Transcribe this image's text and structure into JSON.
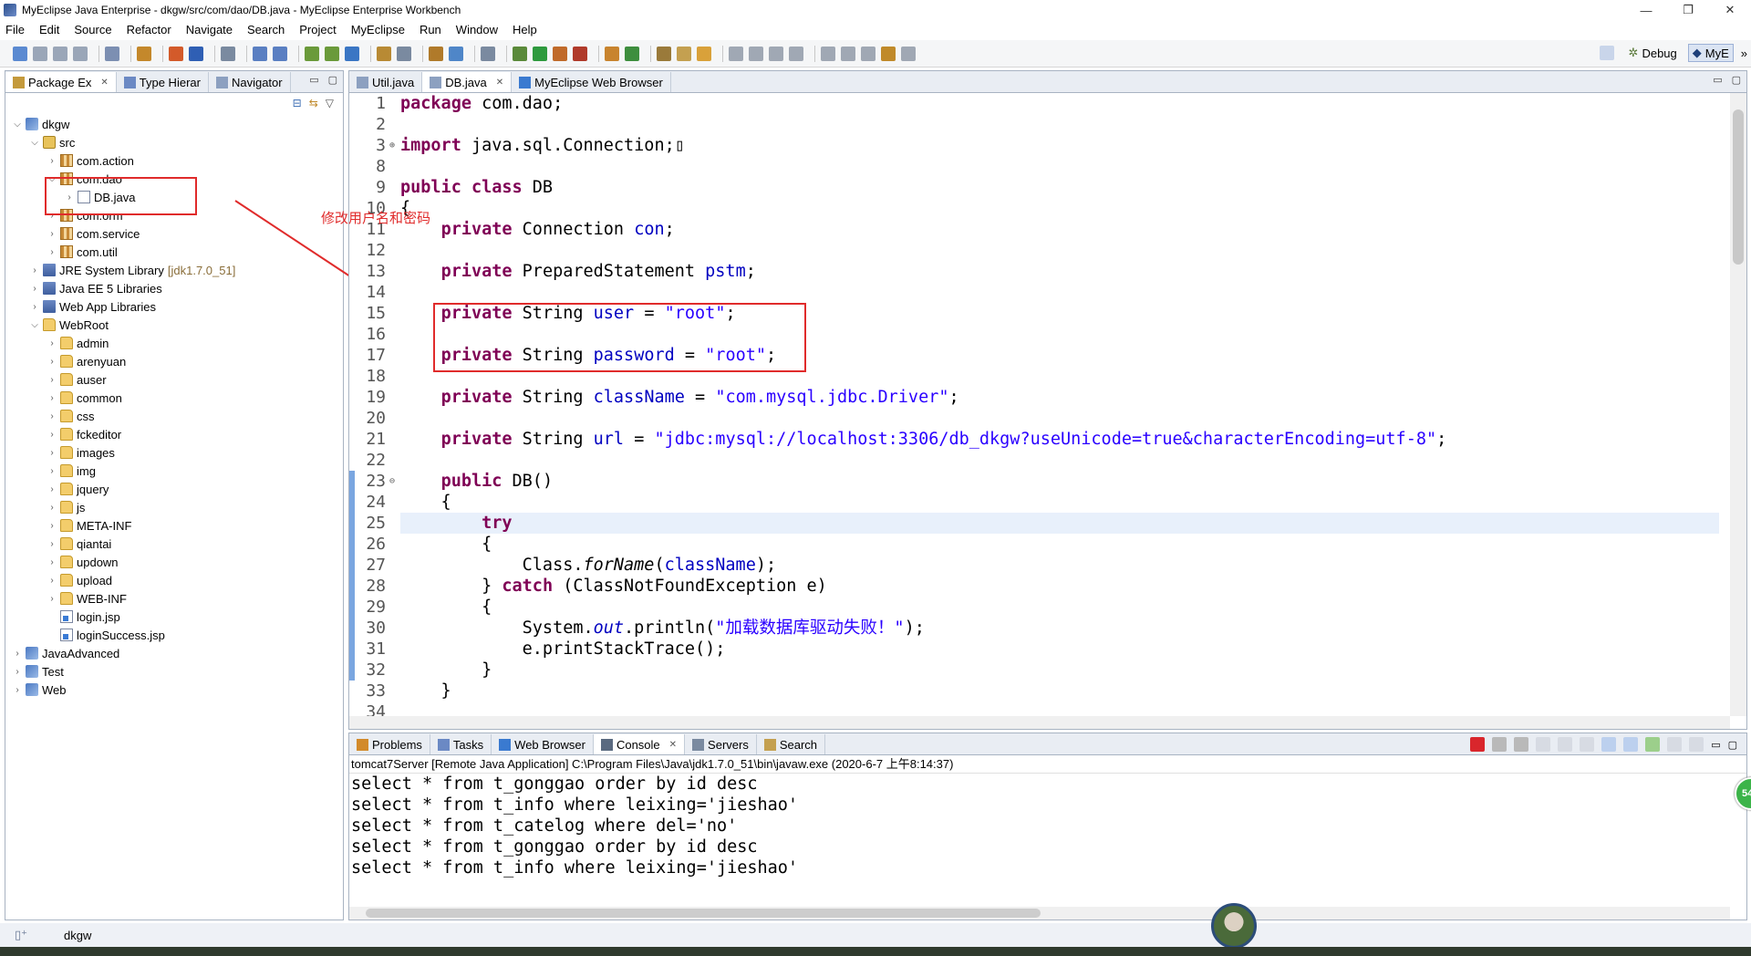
{
  "window": {
    "title": "MyEclipse Java Enterprise - dkgw/src/com/dao/DB.java - MyEclipse Enterprise Workbench",
    "controls": [
      "—",
      "❐",
      "✕"
    ]
  },
  "menubar": [
    "File",
    "Edit",
    "Source",
    "Refactor",
    "Navigate",
    "Search",
    "Project",
    "MyEclipse",
    "Run",
    "Window",
    "Help"
  ],
  "toolbar": {
    "perspectives": [
      {
        "label": "Debug",
        "icon": "debug-icon",
        "active": false
      },
      {
        "label": "MyE",
        "icon": "myeclipse-icon",
        "active": true
      }
    ],
    "overflow": "»"
  },
  "left_panel": {
    "tabs": [
      {
        "label": "Package Ex",
        "icon": "package-explorer-icon",
        "active": true
      },
      {
        "label": "Type Hierar",
        "icon": "type-hierarchy-icon",
        "active": false
      },
      {
        "label": "Navigator",
        "icon": "navigator-icon",
        "active": false
      }
    ],
    "tree": [
      {
        "label": "dkgw",
        "icon": "project",
        "depth": 0,
        "twisty": "open"
      },
      {
        "label": "src",
        "icon": "srcfolder",
        "depth": 1,
        "twisty": "open"
      },
      {
        "label": "com.action",
        "icon": "package",
        "depth": 2,
        "twisty": "closed"
      },
      {
        "label": "com.dao",
        "icon": "package",
        "depth": 2,
        "twisty": "open"
      },
      {
        "label": "DB.java",
        "icon": "java",
        "depth": 3,
        "twisty": "closed"
      },
      {
        "label": "com.orm",
        "icon": "package",
        "depth": 2,
        "twisty": "closed"
      },
      {
        "label": "com.service",
        "icon": "package",
        "depth": 2,
        "twisty": "closed"
      },
      {
        "label": "com.util",
        "icon": "package",
        "depth": 2,
        "twisty": "closed"
      },
      {
        "label": "JRE System Library",
        "suffix": "[jdk1.7.0_51]",
        "icon": "lib",
        "depth": 1,
        "twisty": "closed"
      },
      {
        "label": "Java EE 5 Libraries",
        "icon": "lib",
        "depth": 1,
        "twisty": "closed"
      },
      {
        "label": "Web App Libraries",
        "icon": "lib",
        "depth": 1,
        "twisty": "closed"
      },
      {
        "label": "WebRoot",
        "icon": "folder",
        "depth": 1,
        "twisty": "open"
      },
      {
        "label": "admin",
        "icon": "folder",
        "depth": 2,
        "twisty": "closed"
      },
      {
        "label": "arenyuan",
        "icon": "folder",
        "depth": 2,
        "twisty": "closed"
      },
      {
        "label": "auser",
        "icon": "folder",
        "depth": 2,
        "twisty": "closed"
      },
      {
        "label": "common",
        "icon": "folder",
        "depth": 2,
        "twisty": "closed"
      },
      {
        "label": "css",
        "icon": "folder",
        "depth": 2,
        "twisty": "closed"
      },
      {
        "label": "fckeditor",
        "icon": "folder",
        "depth": 2,
        "twisty": "closed"
      },
      {
        "label": "images",
        "icon": "folder",
        "depth": 2,
        "twisty": "closed"
      },
      {
        "label": "img",
        "icon": "folder",
        "depth": 2,
        "twisty": "closed"
      },
      {
        "label": "jquery",
        "icon": "folder",
        "depth": 2,
        "twisty": "closed"
      },
      {
        "label": "js",
        "icon": "folder",
        "depth": 2,
        "twisty": "closed"
      },
      {
        "label": "META-INF",
        "icon": "folder",
        "depth": 2,
        "twisty": "closed"
      },
      {
        "label": "qiantai",
        "icon": "folder",
        "depth": 2,
        "twisty": "closed"
      },
      {
        "label": "updown",
        "icon": "folder",
        "depth": 2,
        "twisty": "closed"
      },
      {
        "label": "upload",
        "icon": "folder",
        "depth": 2,
        "twisty": "closed"
      },
      {
        "label": "WEB-INF",
        "icon": "folder",
        "depth": 2,
        "twisty": "closed"
      },
      {
        "label": "login.jsp",
        "icon": "jsp",
        "depth": 2,
        "twisty": "none"
      },
      {
        "label": "loginSuccess.jsp",
        "icon": "jsp",
        "depth": 2,
        "twisty": "none"
      },
      {
        "label": "JavaAdvanced",
        "icon": "project",
        "depth": 0,
        "twisty": "closed"
      },
      {
        "label": "Test",
        "icon": "project",
        "depth": 0,
        "twisty": "closed"
      },
      {
        "label": "Web",
        "icon": "project",
        "depth": 0,
        "twisty": "closed"
      }
    ]
  },
  "editor": {
    "tabs": [
      {
        "label": "Util.java",
        "icon": "java-file-icon",
        "active": false,
        "closable": false
      },
      {
        "label": "DB.java",
        "icon": "java-file-icon",
        "active": true,
        "closable": true
      },
      {
        "label": "MyEclipse Web Browser",
        "icon": "globe-icon",
        "active": false,
        "closable": false
      }
    ],
    "annotation": "修改用户名和密码",
    "lines": [
      {
        "n": "1",
        "tokens": [
          [
            "kw",
            "package"
          ],
          [
            "t",
            " com.dao;"
          ]
        ]
      },
      {
        "n": "2",
        "tokens": []
      },
      {
        "n": "3",
        "fold": "⊕",
        "tokens": [
          [
            "kw",
            "import"
          ],
          [
            "t",
            " java.sql.Connection;"
          ],
          [
            "t",
            "▯"
          ]
        ]
      },
      {
        "n": "8",
        "tokens": []
      },
      {
        "n": "9",
        "tokens": [
          [
            "kw",
            "public class"
          ],
          [
            "t",
            " DB"
          ]
        ]
      },
      {
        "n": "10",
        "tokens": [
          [
            "t",
            "{"
          ]
        ]
      },
      {
        "n": "11",
        "tokens": [
          [
            "t",
            "    "
          ],
          [
            "kw",
            "private"
          ],
          [
            "t",
            " Connection "
          ],
          [
            "fld",
            "con"
          ],
          [
            "t",
            ";"
          ]
        ]
      },
      {
        "n": "12",
        "tokens": []
      },
      {
        "n": "13",
        "tokens": [
          [
            "t",
            "    "
          ],
          [
            "kw",
            "private"
          ],
          [
            "t",
            " PreparedStatement "
          ],
          [
            "fld",
            "pstm"
          ],
          [
            "t",
            ";"
          ]
        ]
      },
      {
        "n": "14",
        "tokens": []
      },
      {
        "n": "15",
        "tokens": [
          [
            "t",
            "    "
          ],
          [
            "kw",
            "private"
          ],
          [
            "t",
            " String "
          ],
          [
            "fld",
            "user"
          ],
          [
            "t",
            " = "
          ],
          [
            "str",
            "\"root\""
          ],
          [
            "t",
            ";"
          ]
        ]
      },
      {
        "n": "16",
        "tokens": []
      },
      {
        "n": "17",
        "tokens": [
          [
            "t",
            "    "
          ],
          [
            "kw",
            "private"
          ],
          [
            "t",
            " String "
          ],
          [
            "fld",
            "password"
          ],
          [
            "t",
            " = "
          ],
          [
            "str",
            "\"root\""
          ],
          [
            "t",
            ";"
          ]
        ]
      },
      {
        "n": "18",
        "tokens": []
      },
      {
        "n": "19",
        "tokens": [
          [
            "t",
            "    "
          ],
          [
            "kw",
            "private"
          ],
          [
            "t",
            " String "
          ],
          [
            "fld",
            "className"
          ],
          [
            "t",
            " = "
          ],
          [
            "str",
            "\"com.mysql.jdbc.Driver\""
          ],
          [
            "t",
            ";"
          ]
        ]
      },
      {
        "n": "20",
        "tokens": []
      },
      {
        "n": "21",
        "tokens": [
          [
            "t",
            "    "
          ],
          [
            "kw",
            "private"
          ],
          [
            "t",
            " String "
          ],
          [
            "fld",
            "url"
          ],
          [
            "t",
            " = "
          ],
          [
            "str",
            "\"jdbc:mysql://localhost:3306/db_dkgw?useUnicode=true&characterEncoding=utf-8\""
          ],
          [
            "t",
            ";"
          ]
        ]
      },
      {
        "n": "22",
        "tokens": []
      },
      {
        "n": "23",
        "fold": "⊖",
        "tokens": [
          [
            "t",
            "    "
          ],
          [
            "kw",
            "public"
          ],
          [
            "t",
            " DB()"
          ]
        ]
      },
      {
        "n": "24",
        "tokens": [
          [
            "t",
            "    {"
          ]
        ]
      },
      {
        "n": "25",
        "hl": true,
        "tokens": [
          [
            "t",
            "        "
          ],
          [
            "kw",
            "try"
          ]
        ]
      },
      {
        "n": "26",
        "tokens": [
          [
            "t",
            "        {"
          ]
        ]
      },
      {
        "n": "27",
        "tokens": [
          [
            "t",
            "            Class."
          ],
          [
            "ital",
            "forName"
          ],
          [
            "t",
            "("
          ],
          [
            "fld",
            "className"
          ],
          [
            "t",
            ");"
          ]
        ]
      },
      {
        "n": "28",
        "tokens": [
          [
            "t",
            "        } "
          ],
          [
            "kw",
            "catch"
          ],
          [
            "t",
            " (ClassNotFoundException e)"
          ]
        ]
      },
      {
        "n": "29",
        "tokens": [
          [
            "t",
            "        {"
          ]
        ]
      },
      {
        "n": "30",
        "tokens": [
          [
            "t",
            "            System."
          ],
          [
            "fldi",
            "out"
          ],
          [
            "t",
            ".println("
          ],
          [
            "str",
            "\"加载数据库驱动失败！\""
          ],
          [
            "t",
            ");"
          ]
        ]
      },
      {
        "n": "31",
        "tokens": [
          [
            "t",
            "            e.printStackTrace();"
          ]
        ]
      },
      {
        "n": "32",
        "tokens": [
          [
            "t",
            "        }"
          ]
        ]
      },
      {
        "n": "33",
        "tokens": [
          [
            "t",
            "    }"
          ]
        ]
      },
      {
        "n": "34",
        "tokens": []
      }
    ]
  },
  "console": {
    "tabs": [
      {
        "label": "Problems",
        "icon": "problems-icon",
        "active": false
      },
      {
        "label": "Tasks",
        "icon": "tasks-icon",
        "active": false
      },
      {
        "label": "Web Browser",
        "icon": "globe-icon",
        "active": false
      },
      {
        "label": "Console",
        "icon": "console-icon",
        "active": true,
        "closable": true
      },
      {
        "label": "Servers",
        "icon": "servers-icon",
        "active": false
      },
      {
        "label": "Search",
        "icon": "search-icon",
        "active": false
      }
    ],
    "description": "tomcat7Server [Remote Java Application] C:\\Program Files\\Java\\jdk1.7.0_51\\bin\\javaw.exe (2020-6-7 上午8:14:37)",
    "output": [
      "select * from t_gonggao order by id desc",
      "select * from t_info where leixing='jieshao'",
      "select * from t_catelog where del='no'",
      "select * from t_gonggao order by id desc",
      "select * from t_info where leixing='jieshao'"
    ]
  },
  "statusbar": {
    "label": "dkgw"
  },
  "badge": {
    "text": "54"
  },
  "colors": {
    "keyword": "#7f0055",
    "field": "#0000c0",
    "string": "#2a00ff",
    "annotation_red": "#e02b2b",
    "current_line": "#e8f0fb"
  }
}
